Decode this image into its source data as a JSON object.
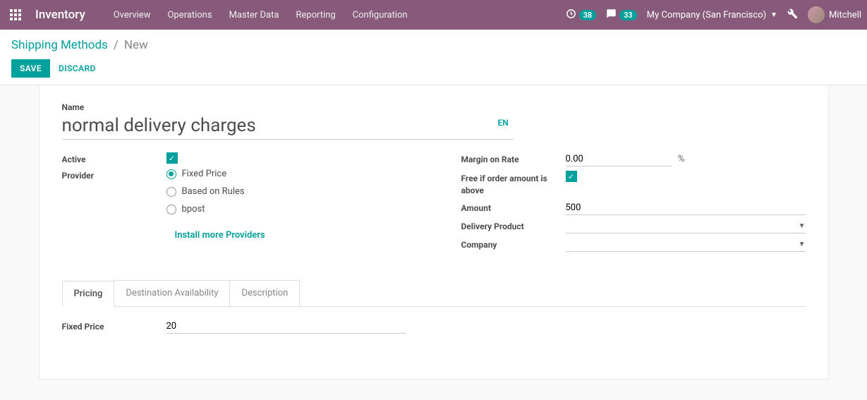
{
  "topnav": {
    "app_title": "Inventory",
    "menu": [
      "Overview",
      "Operations",
      "Master Data",
      "Reporting",
      "Configuration"
    ],
    "activities_badge": "38",
    "messages_badge": "33",
    "company": "My Company (San Francisco)",
    "user_name": "Mitchell"
  },
  "breadcrumb": {
    "parent": "Shipping Methods",
    "current": "New"
  },
  "actions": {
    "save": "SAVE",
    "discard": "DISCARD"
  },
  "form": {
    "name_label": "Name",
    "name_value": "normal delivery charges",
    "lang_btn": "EN",
    "left": {
      "active_label": "Active",
      "active_checked": true,
      "provider_label": "Provider",
      "provider_options": {
        "fixed": "Fixed Price",
        "rules": "Based on Rules",
        "bpost": "bpost"
      },
      "provider_selected": "fixed",
      "install_link": "Install more Providers"
    },
    "right": {
      "margin_label": "Margin on Rate",
      "margin_value": "0.00",
      "margin_unit": "%",
      "free_if_label": "Free if order amount is above",
      "free_if_checked": true,
      "amount_label": "Amount",
      "amount_value": "500",
      "delivery_product_label": "Delivery Product",
      "delivery_product_value": "",
      "company_label": "Company",
      "company_value": ""
    }
  },
  "tabs": {
    "pricing": "Pricing",
    "destination": "Destination Availability",
    "description": "Description"
  },
  "pricing_tab": {
    "fixed_price_label": "Fixed Price",
    "fixed_price_value": "20"
  }
}
